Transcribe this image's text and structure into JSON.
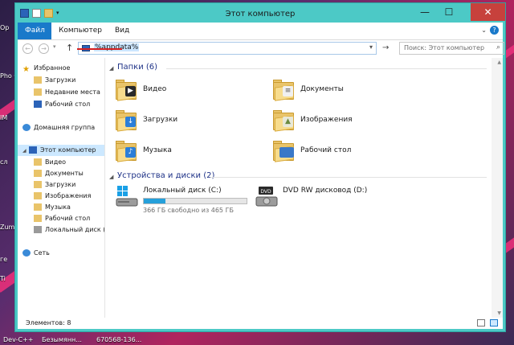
{
  "desktop": {
    "left_labels": [
      "Op",
      "Pho\nC",
      "IM",
      "сл",
      "Zum",
      "ге",
      "Ti",
      "Dev-C++",
      "Безымянн..."
    ],
    "taskbar_item": "670568-136..."
  },
  "window": {
    "title": "Этот компьютер",
    "controls": {
      "minimize": "—",
      "maximize": "☐",
      "close": "✕"
    }
  },
  "menu": {
    "file": "Файл",
    "computer": "Компьютер",
    "view": "Вид",
    "expand_icon": "chevron-down-icon",
    "help": "?"
  },
  "navigation": {
    "address_value": "%appdata%",
    "search_placeholder": "Поиск: Этот компьютер",
    "back": "←",
    "forward": "→",
    "up": "↑",
    "go": "→"
  },
  "sidebar": {
    "favorites": {
      "label": "Избранное",
      "items": [
        "Загрузки",
        "Недавние места",
        "Рабочий стол"
      ]
    },
    "homegroup": "Домашняя группа",
    "computer": {
      "label": "Этот компьютер",
      "items": [
        "Видео",
        "Документы",
        "Загрузки",
        "Изображения",
        "Музыка",
        "Рабочий стол",
        "Локальный диск (C"
      ]
    },
    "network": "Сеть"
  },
  "folders_group": {
    "header": "Папки (6)",
    "items": [
      {
        "name": "Видео",
        "icon": "video-folder-icon"
      },
      {
        "name": "Документы",
        "icon": "documents-folder-icon"
      },
      {
        "name": "Загрузки",
        "icon": "downloads-folder-icon"
      },
      {
        "name": "Изображения",
        "icon": "pictures-folder-icon"
      },
      {
        "name": "Музыка",
        "icon": "music-folder-icon"
      },
      {
        "name": "Рабочий стол",
        "icon": "desktop-folder-icon"
      }
    ]
  },
  "drives_group": {
    "header": "Устройства и диски (2)",
    "items": [
      {
        "name": "Локальный диск (C:)",
        "free_text": "366 ГБ свободно из 465 ГБ",
        "used_fraction": 0.21,
        "icon": "hard-drive-icon"
      },
      {
        "name": "DVD RW дисковод (D:)",
        "icon": "dvd-drive-icon"
      }
    ]
  },
  "status": {
    "items_count": "Элементов: 8"
  },
  "colors": {
    "window_frame": "#4cc9c6",
    "accent": "#1979ca",
    "close": "#c7413c",
    "group_header": "#1e3287",
    "drive_fill": "#26a0da"
  }
}
